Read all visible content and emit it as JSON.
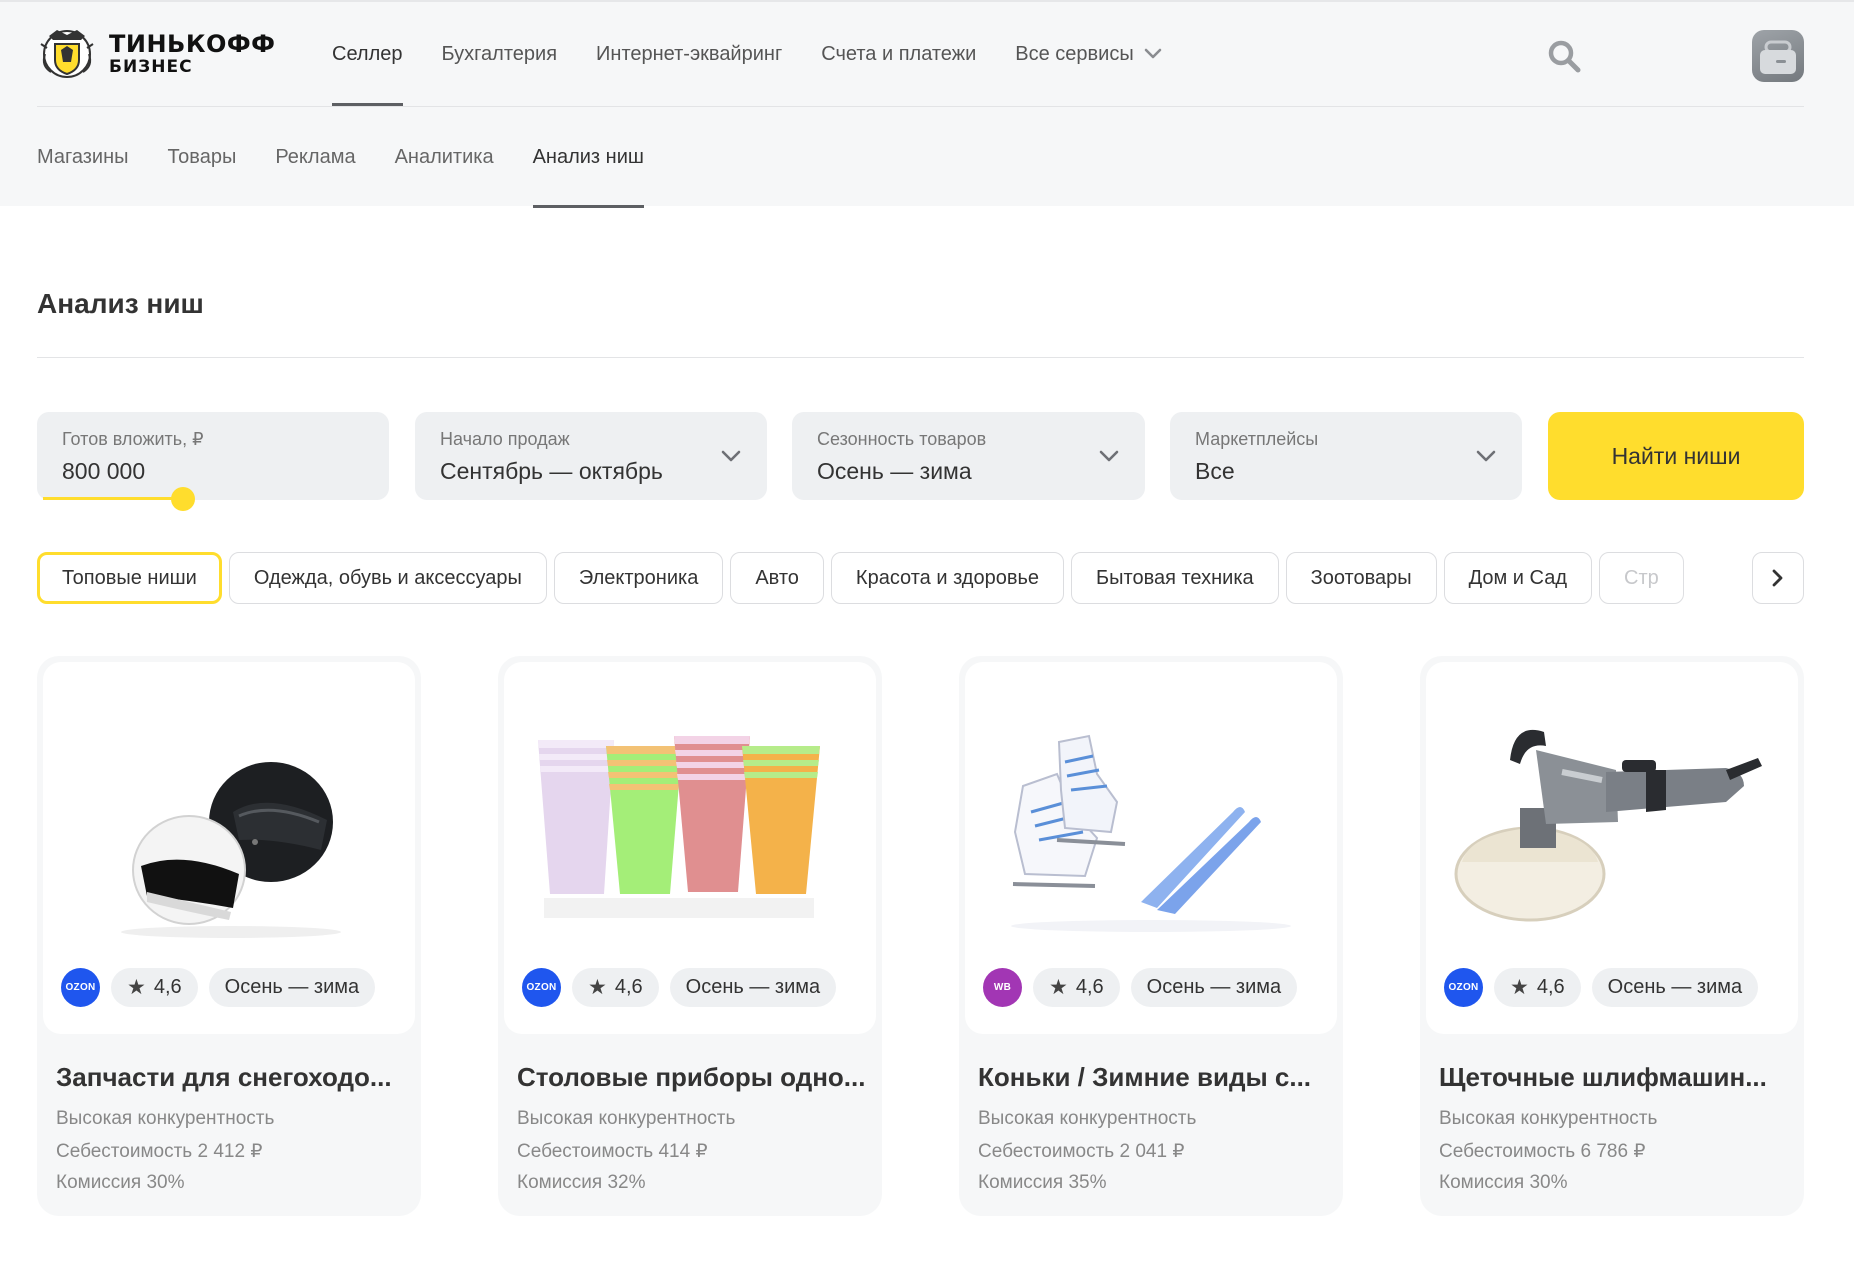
{
  "brand": {
    "line1": "ТИНЬКОФФ",
    "line2": "БИЗНЕС"
  },
  "main_nav": [
    {
      "label": "Селлер",
      "active": true
    },
    {
      "label": "Бухгалтерия",
      "active": false
    },
    {
      "label": "Интернет-эквайринг",
      "active": false
    },
    {
      "label": "Счета и платежи",
      "active": false
    },
    {
      "label": "Все сервисы",
      "active": false
    }
  ],
  "sub_nav": [
    {
      "label": "Магазины",
      "active": false
    },
    {
      "label": "Товары",
      "active": false
    },
    {
      "label": "Реклама",
      "active": false
    },
    {
      "label": "Аналитика",
      "active": false
    },
    {
      "label": "Анализ ниш",
      "active": true
    }
  ],
  "page": {
    "title": "Анализ ниш"
  },
  "filters": {
    "invest": {
      "label": "Готов вложить, ₽",
      "value": "800 000"
    },
    "sales_start": {
      "label": "Начало продаж",
      "value": "Сентябрь — октябрь"
    },
    "seasonality": {
      "label": "Сезонность товаров",
      "value": "Осень — зима"
    },
    "marketplaces": {
      "label": "Маркетплейсы",
      "value": "Все"
    },
    "submit_label": "Найти ниши"
  },
  "categories": [
    {
      "label": "Топовые ниши",
      "active": true
    },
    {
      "label": "Одежда, обувь и аксессуары",
      "active": false
    },
    {
      "label": "Электроника",
      "active": false
    },
    {
      "label": "Авто",
      "active": false
    },
    {
      "label": "Красота и здоровье",
      "active": false
    },
    {
      "label": "Бытовая техника",
      "active": false
    },
    {
      "label": "Зоотовары",
      "active": false
    },
    {
      "label": "Дом и Сад",
      "active": false
    },
    {
      "label": "Стр",
      "active": false
    }
  ],
  "colors": {
    "accent": "#ffdd2d",
    "ozon": "#1f56ee",
    "wb": "#a236b4",
    "page_bg": "#f6f7f8"
  },
  "cards": [
    {
      "image": "helmets",
      "marketplace": "OZON",
      "marketplace_color": "#1f56ee",
      "rating": "4,6",
      "season": "Осень — зима",
      "title": "Запчасти для снегоходо...",
      "competition": "Высокая конкурентность",
      "cost": "Себестоимость 2 412 ₽",
      "commission": "Комиссия 30%"
    },
    {
      "image": "paper-cups",
      "marketplace": "OZON",
      "marketplace_color": "#1f56ee",
      "rating": "4,6",
      "season": "Осень — зима",
      "title": "Столовые приборы одно...",
      "competition": "Высокая конкурентность",
      "cost": "Себестоимость 414 ₽",
      "commission": "Комиссия 32%"
    },
    {
      "image": "ice-skates",
      "marketplace": "WB",
      "marketplace_color": "#a236b4",
      "rating": "4,6",
      "season": "Осень — зима",
      "title": "Коньки / Зимние виды с...",
      "competition": "Высокая конкурентность",
      "cost": "Себестоимость 2 041 ₽",
      "commission": "Комиссия 35%"
    },
    {
      "image": "polisher",
      "marketplace": "OZON",
      "marketplace_color": "#1f56ee",
      "rating": "4,6",
      "season": "Осень — зима",
      "title": "Щеточные шлифмашин...",
      "competition": "Высокая конкурентность",
      "cost": "Себестоимость 6 786 ₽",
      "commission": "Комиссия 30%"
    }
  ]
}
